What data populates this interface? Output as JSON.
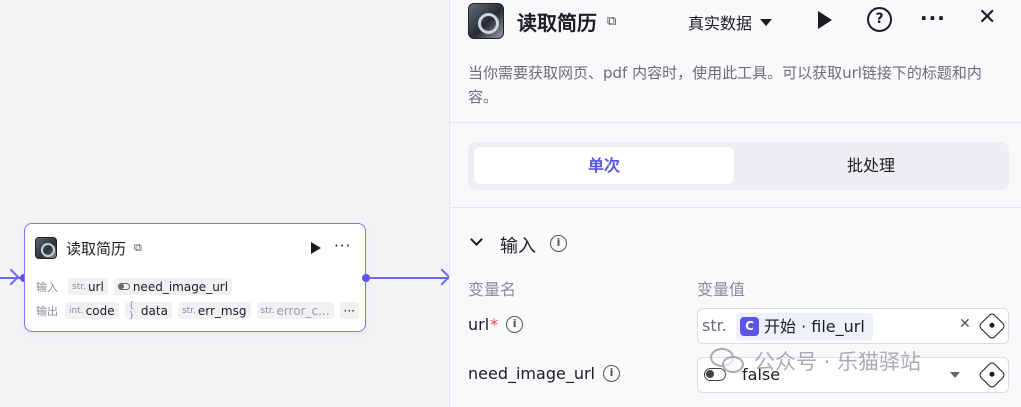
{
  "node": {
    "title": "读取简历",
    "side_icon": "side-panel-icon",
    "input_label": "输入",
    "output_label": "输出",
    "inputs": [
      {
        "type": "str.",
        "name": "url"
      },
      {
        "type": "toggle",
        "name": "need_image_url"
      }
    ],
    "outputs": [
      {
        "type": "int.",
        "name": "code"
      },
      {
        "type": "{ }",
        "name": "data"
      },
      {
        "type": "str.",
        "name": "err_msg"
      },
      {
        "type": "str.",
        "name": "error_c..."
      }
    ],
    "more": "···"
  },
  "panel": {
    "title": "读取简历",
    "data_mode": "真实数据",
    "description": "当你需要获取网页、pdf 内容时，使用此工具。可以获取url链接下的标题和内容。",
    "tabs": [
      "单次",
      "批处理"
    ],
    "section_title": "输入",
    "col_name": "变量名",
    "col_value": "变量值",
    "fields": [
      {
        "name": "url",
        "required": "*",
        "type": "str.",
        "ref": "开始 · file_url"
      },
      {
        "name": "need_image_url",
        "value": "false"
      }
    ]
  },
  "watermark": "公众号 · 乐猫驿站"
}
